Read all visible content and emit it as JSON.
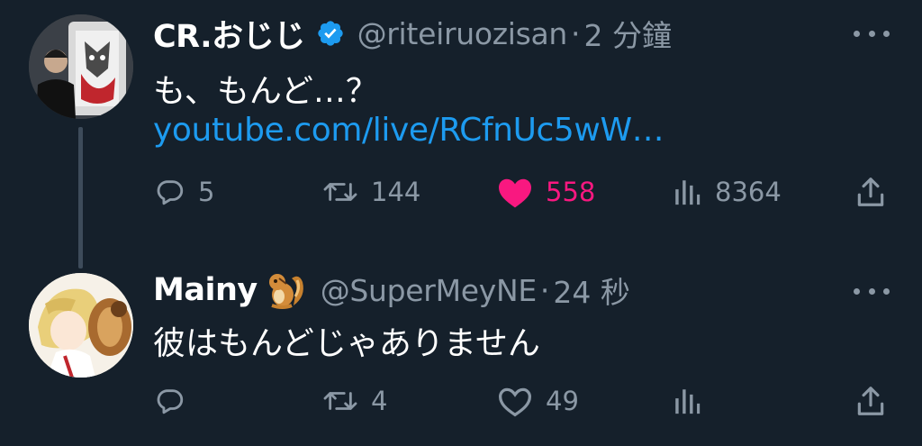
{
  "tweets": [
    {
      "name": "CR.おじじ",
      "verified": true,
      "handle": "@riteiruozisan",
      "separator": "·",
      "time": "2 分鐘",
      "text": "も、もんど…？",
      "link": "youtube.com/live/RCfnUc5wW…",
      "replies": "5",
      "retweets": "144",
      "likes": "558",
      "liked": true,
      "views": "8364"
    },
    {
      "name": "Mainy",
      "emoji": "chipmunk",
      "handle": "@SuperMeyNE",
      "separator": "·",
      "time": "24 秒",
      "text": "彼はもんどじゃありません",
      "replies": "",
      "retweets": "4",
      "likes": "49",
      "liked": false,
      "views": ""
    }
  ],
  "colors": {
    "background": "#15202b",
    "text": "#ffffff",
    "secondary": "#8b98a5",
    "link": "#1d9bf0",
    "like": "#f91880",
    "verified": "#1d9bf0"
  }
}
